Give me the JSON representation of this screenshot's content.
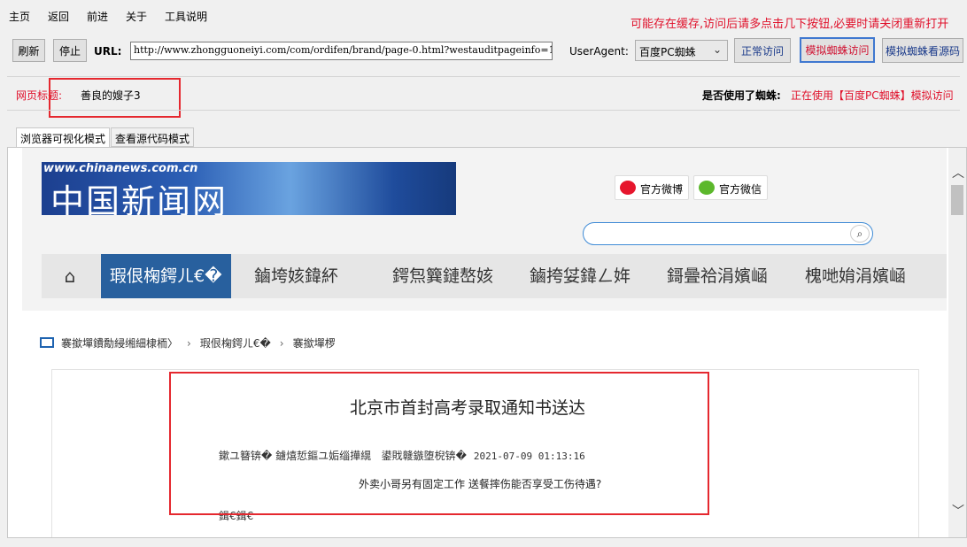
{
  "menu": [
    "主页",
    "返回",
    "前进",
    "关于",
    "工具说明"
  ],
  "notice": "可能存在缓存,访问后请多点击几下按钮,必要时请关闭重新打开",
  "toolbar": {
    "refresh": "刷新",
    "stop": "停止",
    "url_label": "URL:",
    "url_value": "http://www.zhongguoneiyi.com/com/ordifen/brand/page-0.html?westauditpageinfo=1",
    "useragent_label": "UserAgent:",
    "useragent_value": "百度PC蜘蛛",
    "normal_visit": "正常访问",
    "spider_visit": "模拟蜘蛛访问",
    "spider_source": "模拟蜘蛛看源码"
  },
  "page_title": {
    "label": "网页标题:",
    "value": "善良的嫂子3",
    "spider_question": "是否使用了蜘蛛:",
    "spider_answer": "正在使用【百度PC蜘蛛】模拟访问"
  },
  "tabs": [
    "浏览器可视化模式",
    "查看源代码模式"
  ],
  "site": {
    "logo_url": "www.chinanews.com.cn",
    "logo_name": "中国新闻网",
    "weibo": "官方微博",
    "wechat": "官方微信",
    "nav": [
      "瑕佷椈鍔ㄦ€�",
      "鏀垮姟鍏紑",
      "鍔炰簨鏈嶅姟",
      "鏀挎姇鍏ㄥ姩",
      "鎶曡祫涓嬪崡",
      "槐哋姢涓嬪崡"
    ],
    "breadcrumb": [
      "褰撳墠鐨勪綅缃細棣栭〉",
      "瑕佷椈鍔ㄦ€�",
      "褰撳墠椤"
    ],
    "headline": "北京市首封高考录取通知书送达",
    "meta_source": "鏉ユ簮锛� 鐪熺悊鏂ユ姤缁撶繉",
    "meta_label": "鍙戝竷鏃堕棿锛�",
    "meta_time": "2021-07-09 01:13:16",
    "subline": "外卖小哥另有固定工作 送餐摔伤能否享受工伤待遇?",
    "tail": "鍓€鍓€"
  }
}
